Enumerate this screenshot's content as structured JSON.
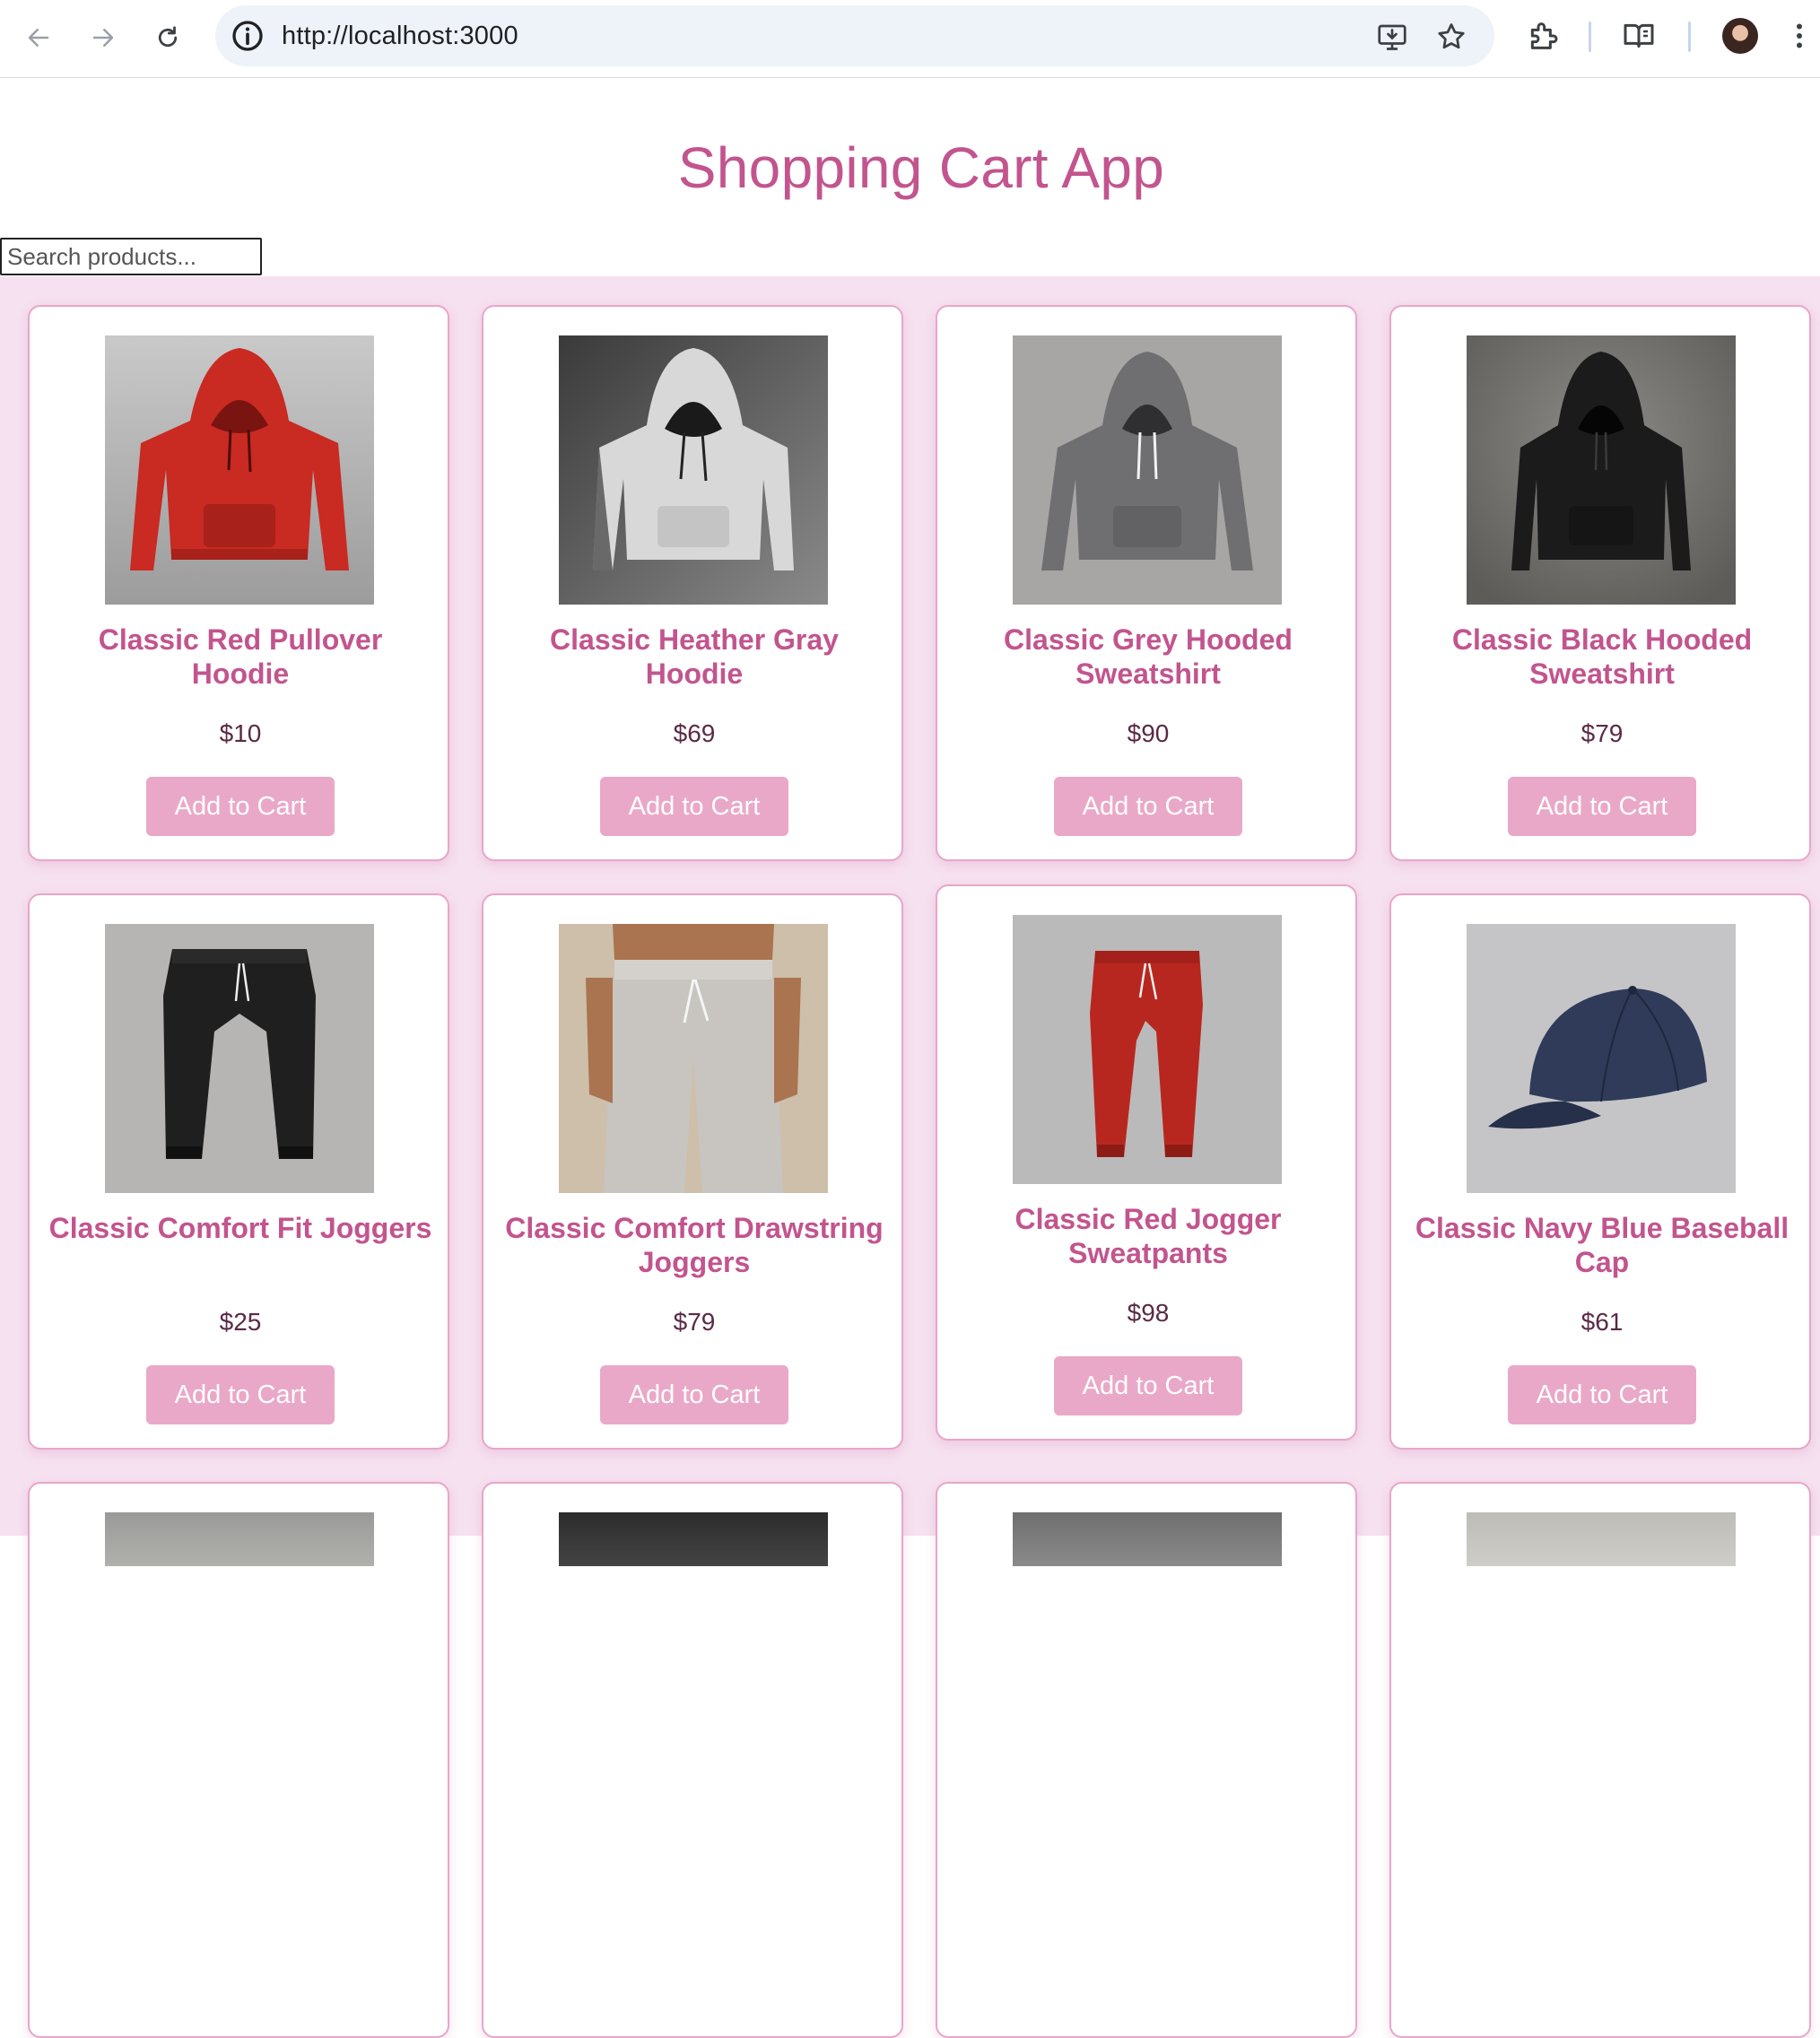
{
  "browser": {
    "url": "http://localhost:3000"
  },
  "app": {
    "title": "Shopping Cart App",
    "search_placeholder": "Search products...",
    "add_label": "Add to Cart",
    "accent_color": "#c2548e",
    "button_color": "#eaa8c8",
    "background_color": "#f6e1f0"
  },
  "products": [
    {
      "name": "Classic Red Pullover Hoodie",
      "price": "$10",
      "image": "red-hoodie"
    },
    {
      "name": "Classic Heather Gray Hoodie",
      "price": "$69",
      "image": "heather-gray-hoodie"
    },
    {
      "name": "Classic Grey Hooded Sweatshirt",
      "price": "$90",
      "image": "grey-hooded-sweatshirt"
    },
    {
      "name": "Classic Black Hooded Sweatshirt",
      "price": "$79",
      "image": "black-hooded-sweatshirt"
    },
    {
      "name": "Classic Comfort Fit Joggers",
      "price": "$25",
      "image": "black-joggers"
    },
    {
      "name": "Classic Comfort Drawstring Joggers",
      "price": "$79",
      "image": "beige-drawstring-joggers"
    },
    {
      "name": "Classic Red Jogger Sweatpants",
      "price": "$98",
      "image": "red-jogger-sweatpants"
    },
    {
      "name": "Classic Navy Blue Baseball Cap",
      "price": "$61",
      "image": "navy-baseball-cap"
    }
  ]
}
